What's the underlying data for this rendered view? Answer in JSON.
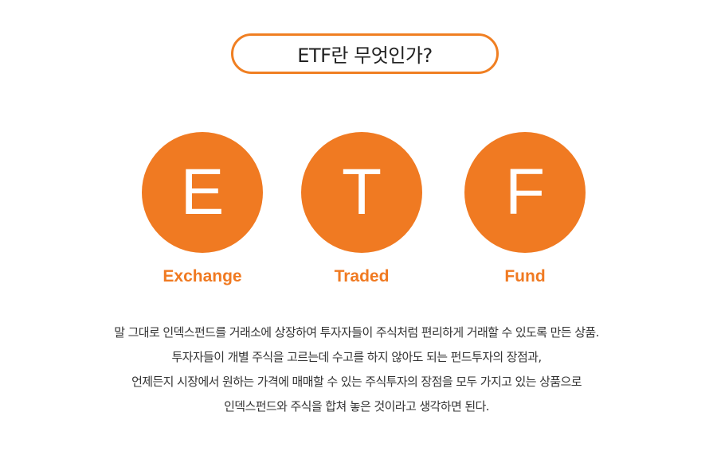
{
  "title": "ETF란 무엇인가?",
  "letters": [
    {
      "letter": "E",
      "word": "Exchange"
    },
    {
      "letter": "T",
      "word": "Traded"
    },
    {
      "letter": "F",
      "word": "Fund"
    }
  ],
  "description": [
    "말 그대로 인덱스펀드를 거래소에 상장하여 투자자들이 주식처럼 편리하게 거래할 수 있도록 만든 상품.",
    "투자자들이 개별 주식을 고르는데 수고를 하지 않아도 되는 펀드투자의 장점과,",
    "언제든지 시장에서 원하는 가격에 매매할 수 있는 주식투자의 장점을 모두 가지고 있는 상품으로",
    "인덱스펀드와 주식을 합쳐 놓은 것이라고 생각하면 된다."
  ],
  "colors": {
    "accent": "#f07a22",
    "text": "#333333"
  }
}
